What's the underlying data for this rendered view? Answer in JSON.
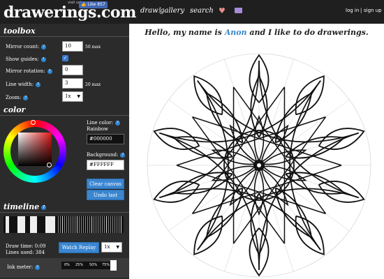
{
  "header": {
    "visit_text": "visit us!",
    "fb_label": "Like 857",
    "logo": "drawerings.com",
    "nav": {
      "draw": "draw!",
      "gallery": "gallery",
      "search": "search"
    },
    "auth": {
      "login": "log in",
      "sep": "|",
      "signup": "sign up"
    }
  },
  "toolbox": {
    "title": "toolbox",
    "mirror_count": {
      "label": "Mirror count:",
      "value": "10",
      "suffix": "50 max"
    },
    "show_guides": {
      "label": "Show guides:",
      "checked": true,
      "mark": "✓"
    },
    "mirror_rotation": {
      "label": "Mirror rotation:",
      "value": "0"
    },
    "line_width": {
      "label": "Line width:",
      "value": "3",
      "suffix": "20 max"
    },
    "zoom": {
      "label": "Zoom:",
      "value": "1x"
    }
  },
  "color": {
    "title": "color",
    "line_color_label": "Line color:",
    "line_color_mode": "Rainbow",
    "line_color_value": "#000000",
    "background_label": "Background:",
    "background_value": "#FFFFFF",
    "clear_button": "Clear canvas",
    "undo_button": "Undo last"
  },
  "timeline": {
    "title": "timeline",
    "draw_time": "Draw time: 0:09",
    "lines_used": "Lines used: 384",
    "watch_replay": "Watch Replay",
    "replay_speed": "1x",
    "ink_meter_label": "Ink meter:",
    "ink_ticks": [
      "0%",
      "25%",
      "50%",
      "75%"
    ]
  },
  "main": {
    "headline_pre": "Hello, my name is ",
    "headline_name": "Anon",
    "headline_post": " and I like to do drawerings."
  },
  "colors": {
    "accent": "#3b86d1",
    "sidebar": "#2b2b2b",
    "topbar": "#1f1f1f",
    "heart": "#e88b8b"
  }
}
